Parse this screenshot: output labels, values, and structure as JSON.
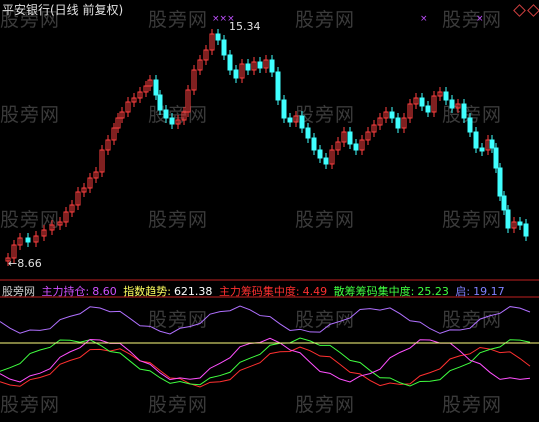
{
  "header": {
    "title": "平安银行(日线 前复权)",
    "high_label": "15.34",
    "low_label": "←8.66"
  },
  "watermark": "股旁网",
  "indicator_bar": {
    "name": "股旁网",
    "items": [
      {
        "label": "主力持仓:",
        "value": "8.60",
        "color": "#d050ff"
      },
      {
        "label": "指数趋势:",
        "value": "621.38",
        "color": "#ffff60"
      },
      {
        "label": "主力筹码集中度:",
        "value": "4.49",
        "color": "#ff3030"
      },
      {
        "label": "散筹筹码集中度:",
        "value": "25.23",
        "color": "#40ff40"
      },
      {
        "label": "启:",
        "value": "19.17",
        "color": "#8080ff"
      }
    ]
  },
  "colors": {
    "up": "#ff4040",
    "down": "#40ffff",
    "axis": "#c02020",
    "purple": "#b070ff",
    "red": "#ff3030",
    "green": "#40ff40",
    "magenta": "#ff50ff",
    "yellow": "#ffff80"
  },
  "chart_data": {
    "type": "candlestick",
    "high_marker": 15.34,
    "low_marker": 8.66,
    "indicator_reference": "horizontal line"
  }
}
